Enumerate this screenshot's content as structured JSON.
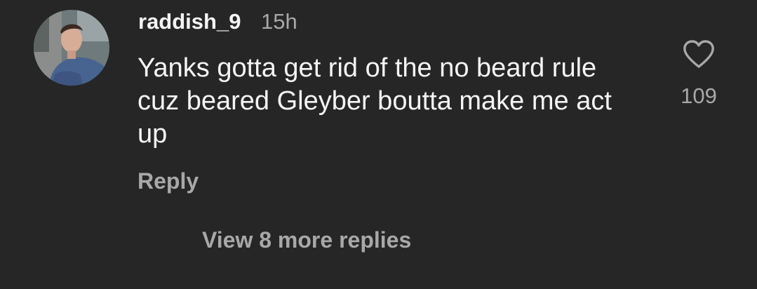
{
  "comment": {
    "username": "raddish_9",
    "time_ago": "15h",
    "text": "Yanks gotta get rid of the no beard rule cuz beared Gleyber boutta make me act up",
    "reply_label": "Reply",
    "like_count": "109",
    "like_icon": "heart-outline-icon"
  },
  "replies": {
    "view_more_label": "View 8 more replies"
  },
  "colors": {
    "background": "#262626",
    "primary_text": "#f5f5f5",
    "secondary_text": "#a8a8a8"
  }
}
